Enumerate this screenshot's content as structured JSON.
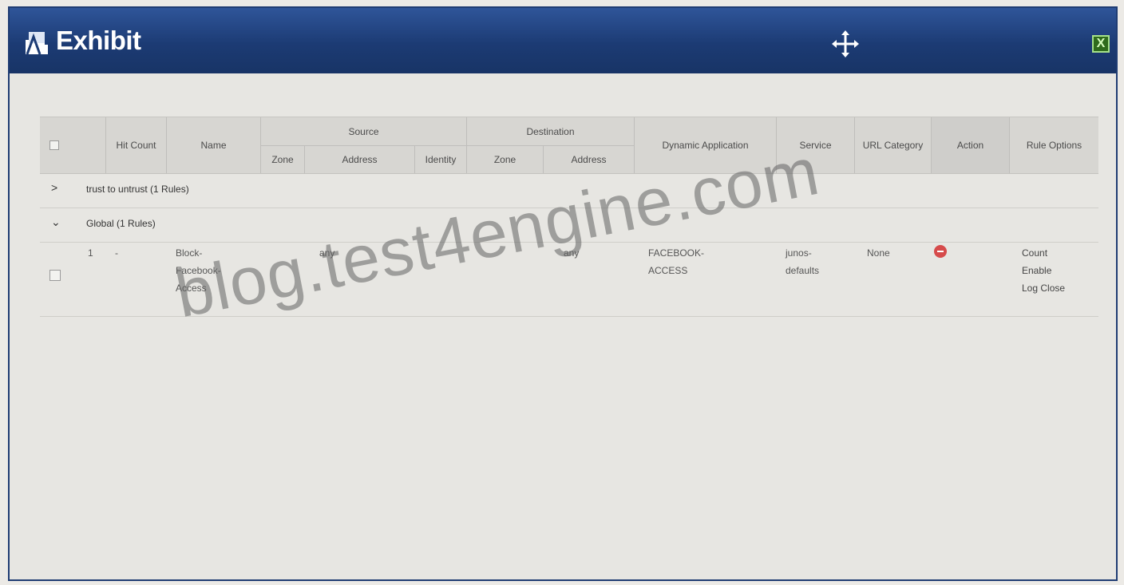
{
  "window": {
    "title": "Exhibit",
    "close_label": "X"
  },
  "table": {
    "headers": {
      "hit_count": "Hit Count",
      "name": "Name",
      "source": "Source",
      "source_zone": "Zone",
      "source_address": "Address",
      "source_identity": "Identity",
      "destination": "Destination",
      "dest_zone": "Zone",
      "dest_address": "Address",
      "dynamic_application": "Dynamic Application",
      "service": "Service",
      "url_category": "URL Category",
      "action": "Action",
      "rule_options": "Rule Options"
    },
    "groups": [
      {
        "label": "trust to untrust (1 Rules)",
        "toggle": ">"
      },
      {
        "label": "Global (1 Rules)",
        "toggle": "⌄"
      }
    ],
    "rule": {
      "index": "1",
      "hit_count": "-",
      "name": "Block-\nFacebook-\nAccess",
      "source_address": "any",
      "dest_address": "any",
      "dynamic_application": "FACEBOOK-\nACCESS",
      "service": "junos-\ndefaults",
      "url_category": "None",
      "action_icon": "deny-icon",
      "rule_options": "Count\nEnable\nLog Close"
    }
  },
  "watermark": "blog.test4engine.com"
}
